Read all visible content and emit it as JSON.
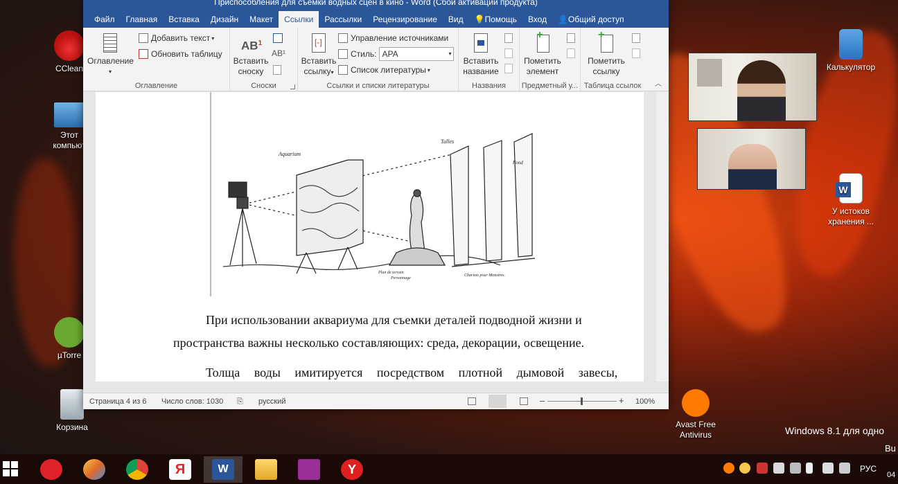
{
  "desktop": {
    "icons_left": [
      {
        "label": "CCleaner",
        "label_shown": "CClean"
      },
      {
        "label": "Этот компьютер",
        "line1": "Этот",
        "line2": "компьют"
      },
      {
        "label": "µTorrent",
        "label_shown": "µTorre"
      },
      {
        "label": "Корзина"
      }
    ],
    "icons_right": [
      {
        "label": "Калькулятор"
      },
      {
        "line1": "У истоков",
        "line2": "хранения ..."
      },
      {
        "line1": "Avast Free",
        "line2": "Antivirus"
      }
    ],
    "watermark_line1": "Windows 8.1 для одно",
    "watermark_line2": "Bu"
  },
  "word": {
    "title": "Приспособления для съемки водных сцен в кино - Word (Сбой активации продукта)",
    "tabs": [
      "Файл",
      "Главная",
      "Вставка",
      "Дизайн",
      "Макет",
      "Ссылки",
      "Рассылки",
      "Рецензирование",
      "Вид",
      "Помощь",
      "Вход",
      "Общий доступ"
    ],
    "active_tab": "Ссылки",
    "ribbon": {
      "toc": {
        "button": "Оглавление",
        "add_text": "Добавить текст",
        "update_table": "Обновить таблицу",
        "group_label": "Оглавление"
      },
      "footnotes": {
        "button_line1": "Вставить",
        "button_line2": "сноску",
        "group_label": "Сноски"
      },
      "citations": {
        "button_line1": "Вставить",
        "button_line2": "ссылку",
        "manage_sources": "Управление источниками",
        "style_label": "Стиль:",
        "style_value": "APA",
        "bibliography": "Список литературы",
        "group_label": "Ссылки и списки литературы"
      },
      "captions": {
        "button_line1": "Вставить",
        "button_line2": "название",
        "group_label": "Названия"
      },
      "index": {
        "button_line1": "Пометить",
        "button_line2": "элемент",
        "group_label": "Предметный у..."
      },
      "toa": {
        "button_line1": "Пометить",
        "button_line2": "ссылку",
        "group_label": "Таблица ссылок"
      }
    },
    "figure_labels": {
      "aquarium": "Aquarium",
      "tulles": "Tulles",
      "fond": "Fond",
      "plan": "Plan de terrain",
      "personnage": "Personnage",
      "chariots": "Chariots pour Monstres."
    },
    "paragraph1_line1": "При использовании аквариума для съемки деталей подводной жизни и",
    "paragraph1_line2": "пространства важны несколько составляющих: среда, декорации, освещение.",
    "paragraph2_line1": "Толща воды имитируется посредством плотной дымовой завесы,",
    "status": {
      "page": "Страница 4 из 6",
      "words": "Число слов: 1030",
      "language": "русский",
      "zoom": "100%"
    }
  },
  "taskbar": {
    "tray_lang": "РУС",
    "clock_partial": "04"
  },
  "colors": {
    "word_blue": "#2b579a",
    "taskbar": "#1a0c08"
  }
}
